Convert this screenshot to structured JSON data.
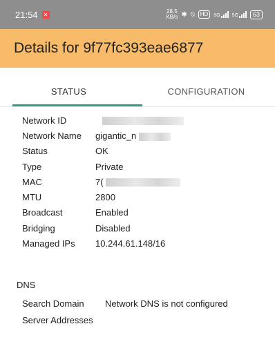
{
  "status_bar": {
    "time": "21:54",
    "notification_icon": "app-notification-icon",
    "speed_value": "28.5",
    "speed_unit": "KB/s",
    "network_badge": "HD",
    "signal_1_label": "5G",
    "signal_2_label": "5G",
    "battery": "63"
  },
  "app_bar": {
    "title": "Details for 9f77fc393eae6877"
  },
  "tabs": [
    {
      "label": "STATUS",
      "selected": true
    },
    {
      "label": "CONFIGURATION",
      "selected": false
    }
  ],
  "details": [
    {
      "label": "Network ID",
      "value": ""
    },
    {
      "label": "Network Name",
      "value": "gigantic_n"
    },
    {
      "label": "Status",
      "value": "OK"
    },
    {
      "label": "Type",
      "value": "Private"
    },
    {
      "label": "MAC",
      "value": "7("
    },
    {
      "label": "MTU",
      "value": "2800"
    },
    {
      "label": "Broadcast",
      "value": "Enabled"
    },
    {
      "label": "Bridging",
      "value": "Disabled"
    },
    {
      "label": "Managed IPs",
      "value": "10.244.61.148/16"
    }
  ],
  "dns": {
    "section_title": "DNS",
    "rows": [
      {
        "label": "Search Domain",
        "value": "Network DNS is not configured"
      },
      {
        "label": "Server Addresses",
        "value": ""
      }
    ]
  },
  "colors": {
    "app_bar": "#f8bb69",
    "status_bar": "#8e8e8e",
    "tab_indicator": "#2f9d93"
  }
}
